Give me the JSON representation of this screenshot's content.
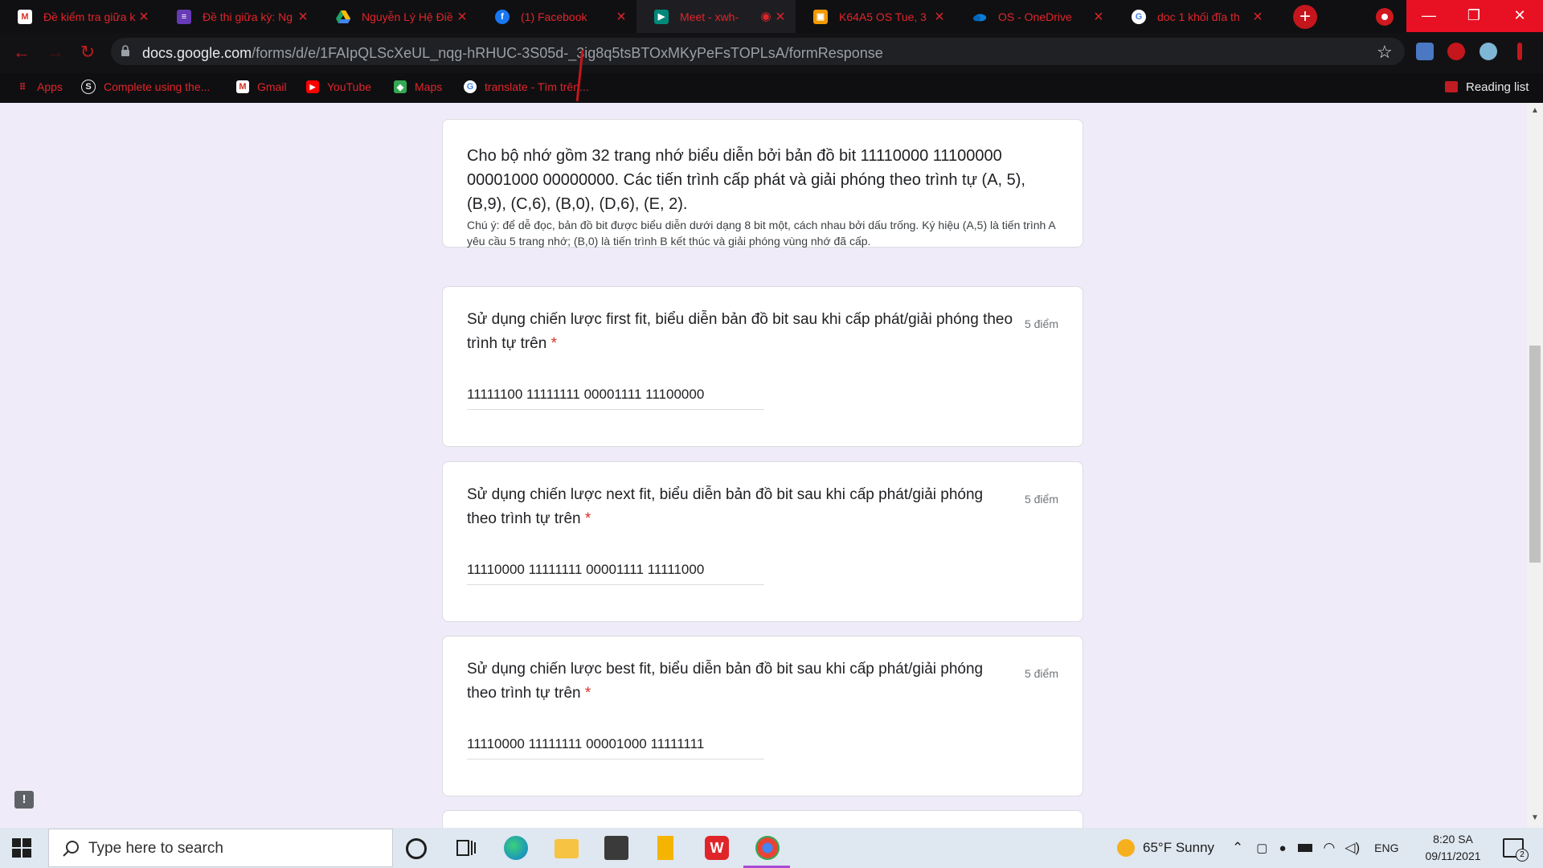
{
  "browser": {
    "tabs": [
      {
        "title": "Đề kiểm tra giữa k",
        "icon": "gmail-icon",
        "color": "#d93025"
      },
      {
        "title": "Đề thi giữa kỳ: Ng",
        "icon": "google-forms-icon",
        "color": "#673ab7"
      },
      {
        "title": "Nguyễn Lý Hệ Điề",
        "icon": "google-drive-icon",
        "color": "#1fa463"
      },
      {
        "title": "(1) Facebook",
        "icon": "facebook-icon",
        "color": "#1877f2"
      },
      {
        "title": "Meet - xwh-",
        "icon": "google-meet-icon",
        "color": "#00897b"
      },
      {
        "title": "K64A5 OS Tue, 3",
        "icon": "google-classroom-icon",
        "color": "#f29900"
      },
      {
        "title": "OS - OneDrive",
        "icon": "onedrive-icon",
        "color": "#0364b8"
      },
      {
        "title": "doc 1 khối đĩa th",
        "icon": "google-search-icon",
        "color": "#4285f4"
      }
    ],
    "url_host": "docs.google.com",
    "url_path": "/forms/d/e/1FAIpQLScXeUL_nqg-hRHUC-3S05d-_3ig8q5tsBTOxMKyPeFsTOPLsA/formResponse",
    "bookmarks": [
      {
        "label": "Apps",
        "icon": "apps-grid-icon"
      },
      {
        "label": "Complete using the...",
        "icon": "s-logo-icon"
      },
      {
        "label": "Gmail",
        "icon": "gmail-icon"
      },
      {
        "label": "YouTube",
        "icon": "youtube-icon"
      },
      {
        "label": "Maps",
        "icon": "maps-icon"
      },
      {
        "label": "translate - Tìm trên...",
        "icon": "google-icon"
      }
    ],
    "reading_list": "Reading list"
  },
  "form": {
    "description": {
      "title": "Cho bộ nhớ gồm 32 trang nhớ biểu diễn bởi bản đồ bit 11110000 11100000 00001000 00000000. Các tiến trình cấp phát và giải phóng theo trình tự (A, 5), (B,9), (C,6), (B,0), (D,6), (E, 2).",
      "note": "Chú ý: để dễ đọc, bản đồ bit được biểu diễn dưới dạng 8 bit một, cách nhau bởi dấu trống. Ký hiệu (A,5) là tiến trình A yêu cầu 5 trang nhớ; (B,0) là tiến trình B kết thúc và giải phóng vùng nhớ đã cấp."
    },
    "questions": [
      {
        "text": "Sử dụng chiến lược first fit, biểu diễn bản đồ bit sau khi cấp phát/giải phóng theo trình tự trên",
        "required": "*",
        "points": "5 điểm",
        "answer": "11111100 11111111 00001111 11100000"
      },
      {
        "text": "Sử dụng chiến lược next fit, biểu diễn bản đồ bit sau khi cấp phát/giải phóng theo trình tự trên",
        "required": "*",
        "points": "5 điểm",
        "answer": "11110000 11111111 00001111 11111000"
      },
      {
        "text": "Sử dụng chiến lược best fit, biểu diễn bản đồ bit sau khi cấp phát/giải phóng theo trình tự trên",
        "required": "*",
        "points": "5 điểm",
        "answer": "11110000 11111111 00001000 11111111"
      }
    ]
  },
  "taskbar": {
    "search_placeholder": "Type here to search",
    "weather": "65°F  Sunny",
    "language": "ENG",
    "time": "8:20 SA",
    "date": "09/11/2021",
    "notifications": "2"
  },
  "colors": {
    "accent_red": "#e0252a",
    "form_background": "#f0ebf8",
    "required": "#d93025"
  }
}
